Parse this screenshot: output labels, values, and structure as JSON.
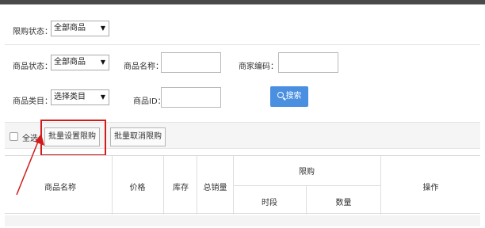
{
  "filters": {
    "limit_status": {
      "label": "限购状态：",
      "value": "全部商品"
    },
    "product_status": {
      "label": "商品状态：",
      "value": "全部商品"
    },
    "product_name": {
      "label": "商品名称：",
      "value": ""
    },
    "merchant_code": {
      "label": "商家编码：",
      "value": ""
    },
    "category": {
      "label": "商品类目：",
      "value": "选择类目"
    },
    "product_id": {
      "label": "商品ID：",
      "value": ""
    },
    "search_label": "搜索"
  },
  "toolbar": {
    "select_all_label": "全选",
    "batch_set_label": "批量设置限购",
    "batch_cancel_label": "批量取消限购"
  },
  "table": {
    "headers": {
      "product_name": "商品名称",
      "price": "价格",
      "stock": "库存",
      "total_sales": "总销量",
      "limit": "限购",
      "period": "时段",
      "quantity": "数量",
      "actions": "操作"
    }
  },
  "colors": {
    "highlight": "#d11a1a",
    "search_button": "#4a8fe0"
  },
  "icons": {
    "search": "search-icon",
    "dropdown": "chevron-down-icon"
  }
}
